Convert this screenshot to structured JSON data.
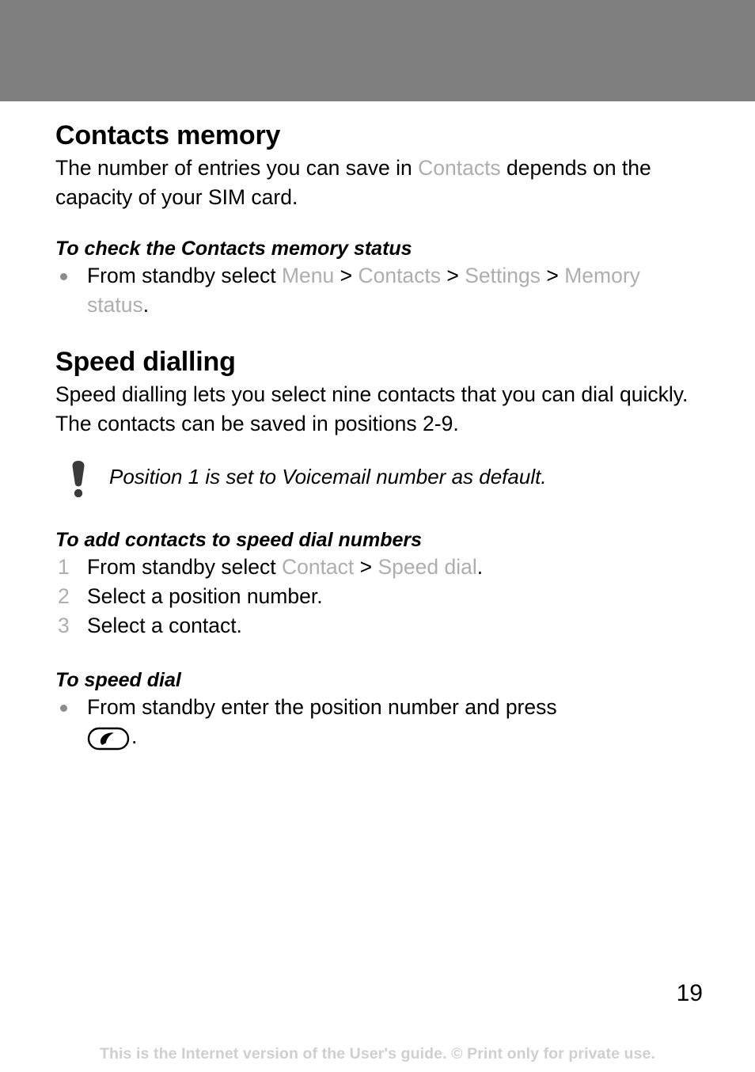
{
  "page": {
    "number": "19",
    "footer": "This is the Internet version of the User's guide. © Print only for private use.",
    "banner_color": "#7f7f7f",
    "ui_term_color": "#aeaeae"
  },
  "sections": [
    {
      "heading": "Contacts memory",
      "body_before_ui": "The number of entries you can save in ",
      "body_ui_term": "Contacts",
      "body_after_ui": " depends on the capacity of your SIM card."
    },
    {
      "heading": "Speed dialling",
      "body": "Speed dialling lets you select nine contacts that you can dial quickly. The contacts can be saved in positions 2-9."
    }
  ],
  "procedure_check_memory": {
    "title": "To check the Contacts memory status",
    "bullet": {
      "lead": "From standby select ",
      "terms": [
        "Menu",
        "Contacts",
        "Settings",
        "Memory status"
      ],
      "separator": ">",
      "trailing": "."
    }
  },
  "note": {
    "icon": "exclamation-mark-icon",
    "text": "Position 1 is set to Voicemail number as default."
  },
  "procedure_add_speed_dial": {
    "title": "To add contacts to speed dial numbers",
    "steps": [
      {
        "number": "1",
        "lead": "From standby select ",
        "terms": [
          "Contact",
          "Speed dial"
        ],
        "separator": ">",
        "trailing": "."
      },
      {
        "number": "2",
        "text": "Select a position number."
      },
      {
        "number": "3",
        "text": "Select a contact."
      }
    ]
  },
  "procedure_speed_dial": {
    "title": "To speed dial",
    "bullet_lead": "From standby enter the position number and press",
    "key_icon": "call-key-icon",
    "trailing": "."
  }
}
